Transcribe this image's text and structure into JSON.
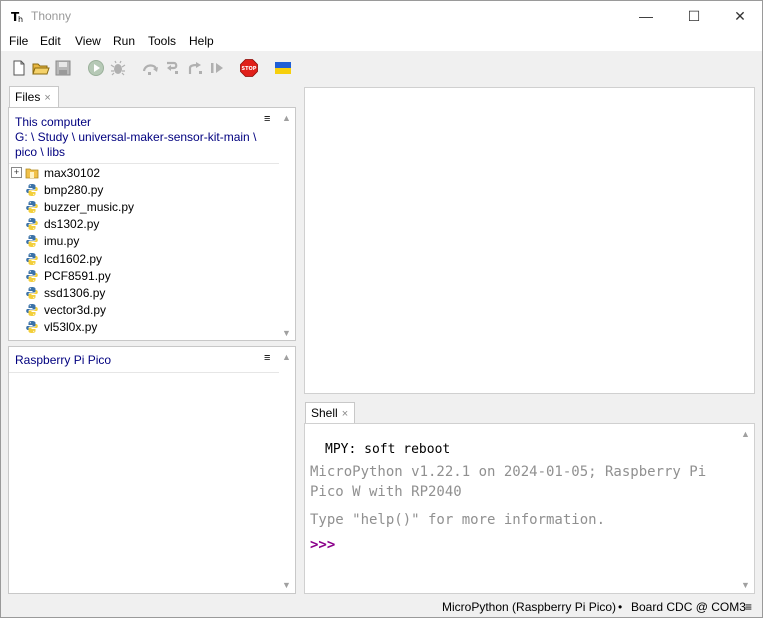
{
  "window": {
    "title": "Thonny"
  },
  "window_controls": {
    "minimize": "—",
    "maximize": "☐",
    "close": "✕"
  },
  "menu": [
    "File",
    "Edit",
    "View",
    "Run",
    "Tools",
    "Help"
  ],
  "toolbar": {
    "icons": [
      "new-file-icon",
      "open-file-icon",
      "save-icon",
      "run-icon",
      "debug-icon",
      "step-over-icon",
      "step-into-icon",
      "step-out-icon",
      "resume-icon",
      "stop-icon",
      "ukraine-flag-icon"
    ],
    "stop_label": "STOP"
  },
  "files_panel": {
    "tab_label": "Files",
    "tab_close": "×",
    "menu_glyph": "≡",
    "this_computer": {
      "heading": "This computer",
      "path_line1": "G: \\ Study \\ universal-maker-sensor-kit-main \\",
      "path_line2": "pico \\ libs",
      "expand_glyph": "+",
      "items": [
        {
          "name": "max30102",
          "type": "folder"
        },
        {
          "name": "bmp280.py",
          "type": "python"
        },
        {
          "name": "buzzer_music.py",
          "type": "python"
        },
        {
          "name": "ds1302.py",
          "type": "python"
        },
        {
          "name": "imu.py",
          "type": "python"
        },
        {
          "name": "lcd1602.py",
          "type": "python"
        },
        {
          "name": "PCF8591.py",
          "type": "python"
        },
        {
          "name": "ssd1306.py",
          "type": "python"
        },
        {
          "name": "vector3d.py",
          "type": "python"
        },
        {
          "name": "vl53l0x.py",
          "type": "python"
        }
      ]
    },
    "device": {
      "heading": "Raspberry Pi Pico"
    }
  },
  "shell": {
    "tab_label": "Shell",
    "tab_close": "×",
    "line1": "MPY: soft reboot",
    "line2": "MicroPython v1.22.1 on 2024-01-05; Raspberry Pi",
    "line3": "Pico W with RP2040",
    "line4": "Type \"help()\" for more information.",
    "prompt": ">>>"
  },
  "statusbar": {
    "interpreter": "MicroPython (Raspberry Pi Pico)",
    "separator": "•",
    "port": "Board CDC @ COM3",
    "menu_glyph": "≡"
  },
  "colors": {
    "accent_blue": "#00007f",
    "prompt_purple": "#8b008b",
    "shell_gray": "#909090"
  }
}
